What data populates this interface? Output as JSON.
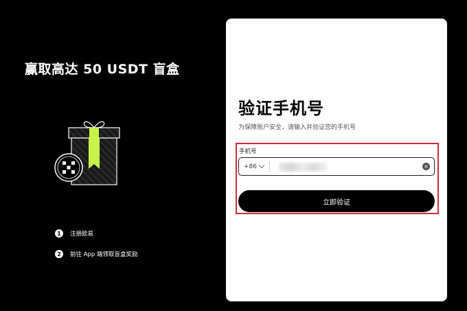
{
  "promo": {
    "title": "赢取高达 50 USDT 盲盒",
    "steps": [
      {
        "number": "1",
        "label": "注册欧易"
      },
      {
        "number": "2",
        "label": "前往 App 端领取盲盒奖励"
      }
    ]
  },
  "form": {
    "title": "验证手机号",
    "subtitle": "为保障账户安全，请输入并验证您的手机号",
    "phone_label": "手机号",
    "country_code": "+86",
    "verify_label": "立即验证"
  },
  "icons": {
    "gift": "gift-box-icon",
    "logo": "okx-logo-icon",
    "chevron": "chevron-down-icon",
    "clear": "clear-icon"
  },
  "colors": {
    "background": "#000000",
    "card": "#ffffff",
    "accent_ribbon": "#c6f44a",
    "highlight_border": "#d2263c",
    "button": "#000000"
  }
}
